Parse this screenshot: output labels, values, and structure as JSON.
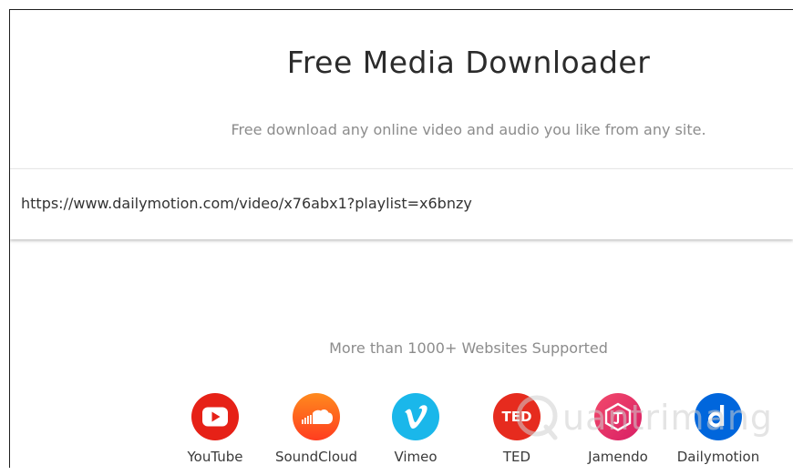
{
  "header": {
    "title": "Free Media Downloader",
    "subtitle": "Free download any online video and audio you like from any site."
  },
  "url_input": {
    "value": "https://www.dailymotion.com/video/x76abx1?playlist=x6bnzy"
  },
  "supported": {
    "text": "More than 1000+ Websites Supported"
  },
  "sites": [
    {
      "label": "YouTube",
      "icon": "youtube-icon",
      "color": "#e62117"
    },
    {
      "label": "SoundCloud",
      "icon": "soundcloud-icon",
      "color": "#ff5a1f"
    },
    {
      "label": "Vimeo",
      "icon": "vimeo-icon",
      "color": "#1ab7ea"
    },
    {
      "label": "TED",
      "icon": "ted-icon",
      "color": "#e62b1e"
    },
    {
      "label": "Jamendo",
      "icon": "jamendo-icon",
      "color": "#e8336a"
    },
    {
      "label": "Dailymotion",
      "icon": "dailymotion-icon",
      "color": "#0066dc"
    }
  ],
  "watermark": {
    "text": "uantrimang",
    "icon": "quantrimang-logo-icon"
  }
}
